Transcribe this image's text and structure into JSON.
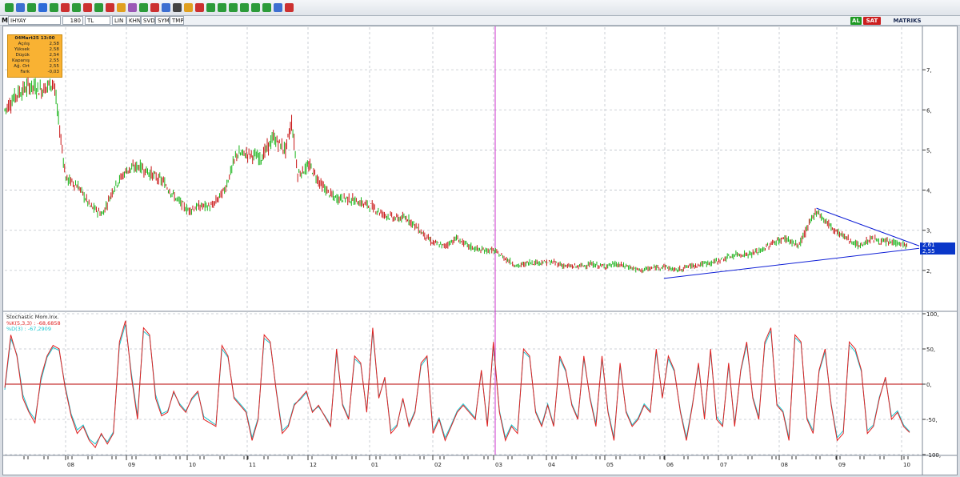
{
  "toolbar": {
    "icons": [
      "lock-icon",
      "cursor-icon",
      "crosshair-icon",
      "trendline-icon",
      "horizontal-line-icon",
      "vertical-line-icon",
      "channel-icon",
      "fibonacci-icon",
      "text-icon",
      "arrow-icon",
      "zoom-in-icon",
      "zoom-out-icon",
      "color-icon",
      "indicator-icon",
      "save-icon",
      "print-icon",
      "settings-icon",
      "magnet-icon",
      "scroll-left-icon",
      "scroll-right-icon",
      "arrow-left-icon",
      "arrow-right-icon",
      "arrow-up-icon",
      "arrow-down-icon",
      "chart-icon",
      "bell-icon"
    ]
  },
  "symbol_bar": {
    "m_label": "M",
    "symbol": "IHYAY",
    "period": "180",
    "currency": "TL",
    "mode_buttons": [
      "LIN",
      "KHN",
      "SVD",
      "SYM",
      "TMP"
    ],
    "buy_label": "AL",
    "sell_label": "SAT",
    "brand": "MATRIKS"
  },
  "info_box": {
    "title": "04Mart25 13:00",
    "rows": [
      {
        "label": "Açılış",
        "value": "2,58"
      },
      {
        "label": "Yüksek",
        "value": "2,58"
      },
      {
        "label": "Düşük",
        "value": "2,54"
      },
      {
        "label": "Kapanış",
        "value": "2,55"
      },
      {
        "label": "Ağ. Ort",
        "value": "2,55"
      },
      {
        "label": "Fark",
        "value": "-0,03"
      }
    ]
  },
  "stochastic_legend": {
    "title": "Stochastic Mom.Inx.",
    "k_label": "%K(5,3,3)",
    "k_value": ": -68,6858",
    "d_label": "%D(3)",
    "d_value": ": -67,2909"
  },
  "last_price": {
    "value": "2,61",
    "secondary": "2,55"
  },
  "colors": {
    "up": "#17b317",
    "down": "#c81414",
    "trend": "#0f1fd6",
    "k_line": "#e02020",
    "d_line": "#19c6cf",
    "zero_line": "#b80000",
    "cursor": "#cc33cc",
    "price_tag": "#0a37c9"
  },
  "chart_data": [
    {
      "type": "candlestick",
      "title": "IHYAY",
      "y_ticks": [
        "2,",
        "3,",
        "4,",
        "5,",
        "6,",
        "7,"
      ],
      "ylim": [
        1,
        8
      ],
      "x_ticks": [
        "08",
        "09",
        "10",
        "11",
        "12",
        "01",
        "02",
        "03",
        "04",
        "05",
        "06",
        "07",
        "08",
        "09",
        "10"
      ],
      "series": [
        {
          "name": "price",
          "values": [
            [
              0,
              6.0
            ],
            [
              2,
              6.4
            ],
            [
              4,
              6.6
            ],
            [
              6,
              6.5
            ],
            [
              8,
              6.7
            ],
            [
              9,
              5.5
            ],
            [
              10,
              4.3
            ],
            [
              12,
              4.1
            ],
            [
              14,
              3.6
            ],
            [
              16,
              3.4
            ],
            [
              18,
              4.1
            ],
            [
              20,
              4.5
            ],
            [
              22,
              4.6
            ],
            [
              24,
              4.4
            ],
            [
              26,
              4.2
            ],
            [
              28,
              3.8
            ],
            [
              30,
              3.5
            ],
            [
              32,
              3.6
            ],
            [
              34,
              3.6
            ],
            [
              36,
              4.0
            ],
            [
              38,
              4.9
            ],
            [
              40,
              4.9
            ],
            [
              42,
              4.8
            ],
            [
              44,
              5.3
            ],
            [
              46,
              5.0
            ],
            [
              47,
              5.7
            ],
            [
              48,
              4.4
            ],
            [
              50,
              4.6
            ],
            [
              52,
              4.1
            ],
            [
              54,
              3.8
            ],
            [
              56,
              3.8
            ],
            [
              58,
              3.7
            ],
            [
              60,
              3.6
            ],
            [
              62,
              3.4
            ],
            [
              64,
              3.3
            ],
            [
              66,
              3.3
            ],
            [
              68,
              3.0
            ],
            [
              70,
              2.7
            ],
            [
              72,
              2.6
            ],
            [
              74,
              2.8
            ],
            [
              76,
              2.6
            ],
            [
              78,
              2.5
            ],
            [
              80,
              2.5
            ],
            [
              82,
              2.3
            ],
            [
              84,
              2.1
            ],
            [
              86,
              2.2
            ],
            [
              88,
              2.2
            ],
            [
              90,
              2.2
            ],
            [
              92,
              2.1
            ],
            [
              94,
              2.1
            ],
            [
              96,
              2.15
            ],
            [
              98,
              2.1
            ],
            [
              100,
              2.15
            ],
            [
              102,
              2.1
            ],
            [
              104,
              2.0
            ],
            [
              106,
              2.05
            ],
            [
              108,
              2.1
            ],
            [
              110,
              2.0
            ],
            [
              112,
              2.1
            ],
            [
              114,
              2.15
            ],
            [
              116,
              2.2
            ],
            [
              118,
              2.3
            ],
            [
              120,
              2.4
            ],
            [
              122,
              2.4
            ],
            [
              124,
              2.5
            ],
            [
              126,
              2.7
            ],
            [
              128,
              2.8
            ],
            [
              130,
              2.6
            ],
            [
              132,
              3.2
            ],
            [
              133,
              3.5
            ],
            [
              134,
              3.3
            ],
            [
              136,
              3.0
            ],
            [
              138,
              2.8
            ],
            [
              140,
              2.6
            ],
            [
              142,
              2.8
            ],
            [
              144,
              2.7
            ],
            [
              146,
              2.7
            ],
            [
              148,
              2.6
            ]
          ]
        },
        {
          "name": "resistance",
          "values": [
            [
              133,
              3.55
            ],
            [
              148,
              2.61
            ]
          ]
        },
        {
          "name": "support",
          "values": [
            [
              108,
              1.8
            ],
            [
              148,
              2.55
            ]
          ]
        }
      ]
    },
    {
      "type": "line",
      "title": "Stochastic Mom.Inx.",
      "y_ticks": [
        "100,",
        "50,",
        "0,",
        "-50,",
        "-100,"
      ],
      "ylim": [
        -100,
        100
      ],
      "series": [
        {
          "name": "%K(5,3,3)",
          "values": [
            -5,
            70,
            40,
            -20,
            -40,
            -55,
            10,
            40,
            55,
            50,
            -5,
            -45,
            -70,
            -60,
            -80,
            -90,
            -70,
            -85,
            -70,
            60,
            90,
            10,
            -50,
            80,
            70,
            -20,
            -45,
            -40,
            -10,
            -30,
            -40,
            -20,
            -10,
            -50,
            -55,
            -60,
            55,
            40,
            -20,
            -30,
            -40,
            -80,
            -50,
            70,
            60,
            -10,
            -70,
            -60,
            -30,
            -20,
            -10,
            -40,
            -30,
            -45,
            -60,
            50,
            -30,
            -50,
            40,
            30,
            -40,
            80,
            -20,
            10,
            -70,
            -60,
            -20,
            -60,
            -40,
            30,
            40,
            -70,
            -50,
            -80,
            -60,
            -40,
            -30,
            -40,
            -50,
            20,
            -60,
            60,
            -40,
            -80,
            -60,
            -70,
            50,
            40,
            -40,
            -60,
            -30,
            -60,
            40,
            20,
            -30,
            -50,
            40,
            -20,
            -60,
            40,
            -40,
            -80,
            30,
            -40,
            -60,
            -50,
            -30,
            -40,
            50,
            -20,
            40,
            20,
            -40,
            -80,
            -30,
            30,
            -50,
            50,
            -50,
            -60,
            30,
            -60,
            20,
            60,
            -20,
            -50,
            60,
            80,
            -30,
            -40,
            -80,
            70,
            60,
            -50,
            -70,
            20,
            50,
            -30,
            -80,
            -70,
            60,
            50,
            20,
            -70,
            -60,
            -20,
            10,
            -50,
            -40,
            -60,
            -68.6858
          ]
        },
        {
          "name": "%D(3)",
          "values": [
            -8,
            65,
            42,
            -15,
            -38,
            -50,
            5,
            38,
            52,
            48,
            -2,
            -42,
            -65,
            -58,
            -78,
            -85,
            -72,
            -82,
            -68,
            55,
            85,
            15,
            -45,
            75,
            68,
            -15,
            -42,
            -38,
            -12,
            -28,
            -38,
            -22,
            -12,
            -46,
            -52,
            -58,
            50,
            38,
            -18,
            -28,
            -38,
            -76,
            -48,
            65,
            58,
            -8,
            -66,
            -58,
            -28,
            -22,
            -12,
            -38,
            -32,
            -44,
            -58,
            45,
            -28,
            -48,
            36,
            28,
            -38,
            75,
            -18,
            8,
            -66,
            -58,
            -22,
            -58,
            -38,
            26,
            38,
            -66,
            -48,
            -76,
            -58,
            -38,
            -28,
            -38,
            -48,
            18,
            -56,
            55,
            -38,
            -76,
            -58,
            -66,
            46,
            38,
            -38,
            -58,
            -28,
            -58,
            36,
            18,
            -28,
            -48,
            36,
            -18,
            -56,
            36,
            -38,
            -76,
            26,
            -38,
            -58,
            -48,
            -28,
            -38,
            46,
            -18,
            36,
            18,
            -38,
            -76,
            -28,
            26,
            -46,
            46,
            -46,
            -58,
            26,
            -56,
            18,
            56,
            -18,
            -46,
            56,
            76,
            -28,
            -38,
            -76,
            66,
            58,
            -48,
            -66,
            18,
            46,
            -28,
            -76,
            -66,
            56,
            46,
            18,
            -66,
            -58,
            -18,
            8,
            -46,
            -38,
            -58,
            -67.2909
          ]
        }
      ]
    }
  ]
}
